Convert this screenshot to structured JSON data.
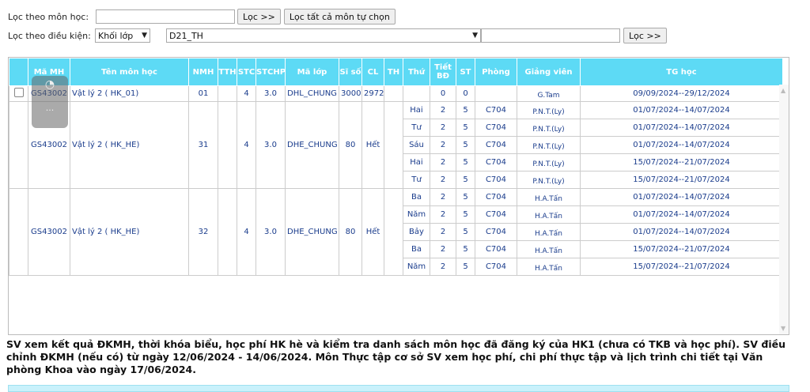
{
  "filter": {
    "subject_label": "Lọc theo môn học:",
    "subject_value": "",
    "filter_btn": "Lọc >>",
    "filter_all_btn": "Lọc tất cả môn tự chọn",
    "condition_label": "Lọc theo điều kiện:",
    "condition_select": "Khối lớp",
    "class_select": "D21_TH",
    "class_text": "",
    "filter_btn2": "Lọc >>"
  },
  "table": {
    "headers": [
      "",
      "Mã MH",
      "Tên môn học",
      "NMH",
      "TTH",
      "STC",
      "STCHP",
      "Mã lớp",
      "Sĩ số",
      "CL",
      "TH",
      "Thứ",
      "Tiết BĐ",
      "ST",
      "Phòng",
      "Giảng viên",
      "TG học"
    ],
    "groups": [
      {
        "code": "GS43002",
        "name": "Vật lý 2 ( HK_01)",
        "nmh": "01",
        "tth": "",
        "stc": "4",
        "stchp": "3.0",
        "class": "DHL_CHUNG",
        "siso": "3000",
        "cl": "2972",
        "th": "",
        "sessions": [
          {
            "day": "",
            "start": "0",
            "st": "0",
            "room": "",
            "teacher": "G.Tam",
            "time": "09/09/2024--29/12/2024"
          }
        ]
      },
      {
        "code": "GS43002",
        "name": "Vật lý 2 ( HK_HE)",
        "nmh": "31",
        "tth": "",
        "stc": "4",
        "stchp": "3.0",
        "class": "DHE_CHUNG",
        "siso": "80",
        "cl": "Hết",
        "th": "",
        "sessions": [
          {
            "day": "Hai",
            "start": "2",
            "st": "5",
            "room": "C704",
            "teacher": "P.N.T.(Ly)",
            "time": "01/07/2024--14/07/2024"
          },
          {
            "day": "Tư",
            "start": "2",
            "st": "5",
            "room": "C704",
            "teacher": "P.N.T.(Ly)",
            "time": "01/07/2024--14/07/2024"
          },
          {
            "day": "Sáu",
            "start": "2",
            "st": "5",
            "room": "C704",
            "teacher": "P.N.T.(Ly)",
            "time": "01/07/2024--14/07/2024"
          },
          {
            "day": "Hai",
            "start": "2",
            "st": "5",
            "room": "C704",
            "teacher": "P.N.T.(Ly)",
            "time": "15/07/2024--21/07/2024"
          },
          {
            "day": "Tư",
            "start": "2",
            "st": "5",
            "room": "C704",
            "teacher": "P.N.T.(Ly)",
            "time": "15/07/2024--21/07/2024"
          }
        ]
      },
      {
        "code": "GS43002",
        "name": "Vật lý 2 ( HK_HE)",
        "nmh": "32",
        "tth": "",
        "stc": "4",
        "stchp": "3.0",
        "class": "DHE_CHUNG",
        "siso": "80",
        "cl": "Hết",
        "th": "",
        "sessions": [
          {
            "day": "Ba",
            "start": "2",
            "st": "5",
            "room": "C704",
            "teacher": "H.A.Tấn",
            "time": "01/07/2024--14/07/2024"
          },
          {
            "day": "Năm",
            "start": "2",
            "st": "5",
            "room": "C704",
            "teacher": "H.A.Tấn",
            "time": "01/07/2024--14/07/2024"
          },
          {
            "day": "Bảy",
            "start": "2",
            "st": "5",
            "room": "C704",
            "teacher": "H.A.Tấn",
            "time": "01/07/2024--14/07/2024"
          },
          {
            "day": "Ba",
            "start": "2",
            "st": "5",
            "room": "C704",
            "teacher": "H.A.Tấn",
            "time": "15/07/2024--21/07/2024"
          },
          {
            "day": "Năm",
            "start": "2",
            "st": "5",
            "room": "C704",
            "teacher": "H.A.Tấn",
            "time": "15/07/2024--21/07/2024"
          }
        ]
      }
    ]
  },
  "overlay": {
    "dots": "..."
  },
  "notice": "SV xem kết quả ĐKMH, thời khóa biểu, học phí HK hè và kiểm tra danh sách môn học đã đăng ký của HK1 (chưa có TKB và học phí). SV điều chỉnh ĐKMH (nếu có) từ ngày 12/06/2024 - 14/06/2024. Môn Thực tập cơ sở SV xem học phí, chi phí thực tập và lịch trình chi tiết tại Văn phòng Khoa vào ngày 17/06/2024.",
  "colors": {
    "header_bg": "#5ddaf5",
    "link": "#1a3c8c"
  }
}
